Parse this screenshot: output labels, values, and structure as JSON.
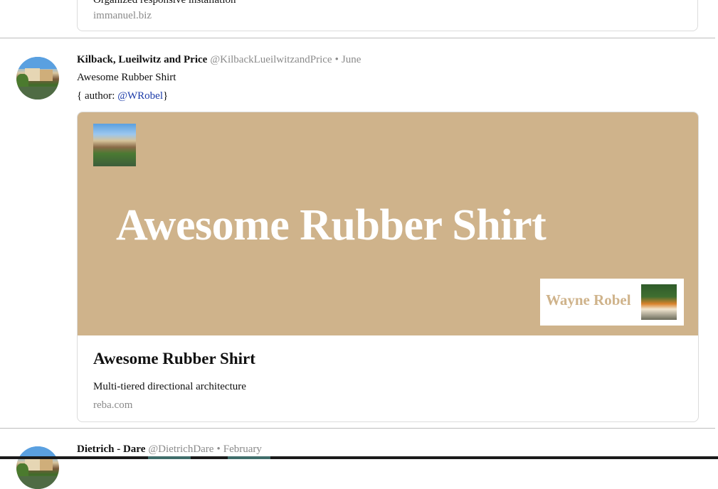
{
  "previous_post": {
    "description": "Organized responsive installation",
    "domain": "immanuel.biz"
  },
  "post": {
    "author": "Kilback, Lueilwitz and Price",
    "handle": "@KilbackLueilwitzandPrice",
    "separator": "•",
    "date": "June",
    "text": "Awesome Rubber Shirt",
    "meta_prefix": "{ author: ",
    "mention": "@WRobel",
    "meta_suffix": "}",
    "card": {
      "banner_title": "Awesome Rubber Shirt",
      "badge_name": "Wayne Robel",
      "title": "Awesome Rubber Shirt",
      "description": "Multi-tiered directional architecture",
      "domain": "reba.com",
      "banner_color": "#cfb38b"
    }
  },
  "next_post": {
    "author": "Dietrich - Dare",
    "handle": "@DietrichDare",
    "separator": "•",
    "date": "February"
  }
}
